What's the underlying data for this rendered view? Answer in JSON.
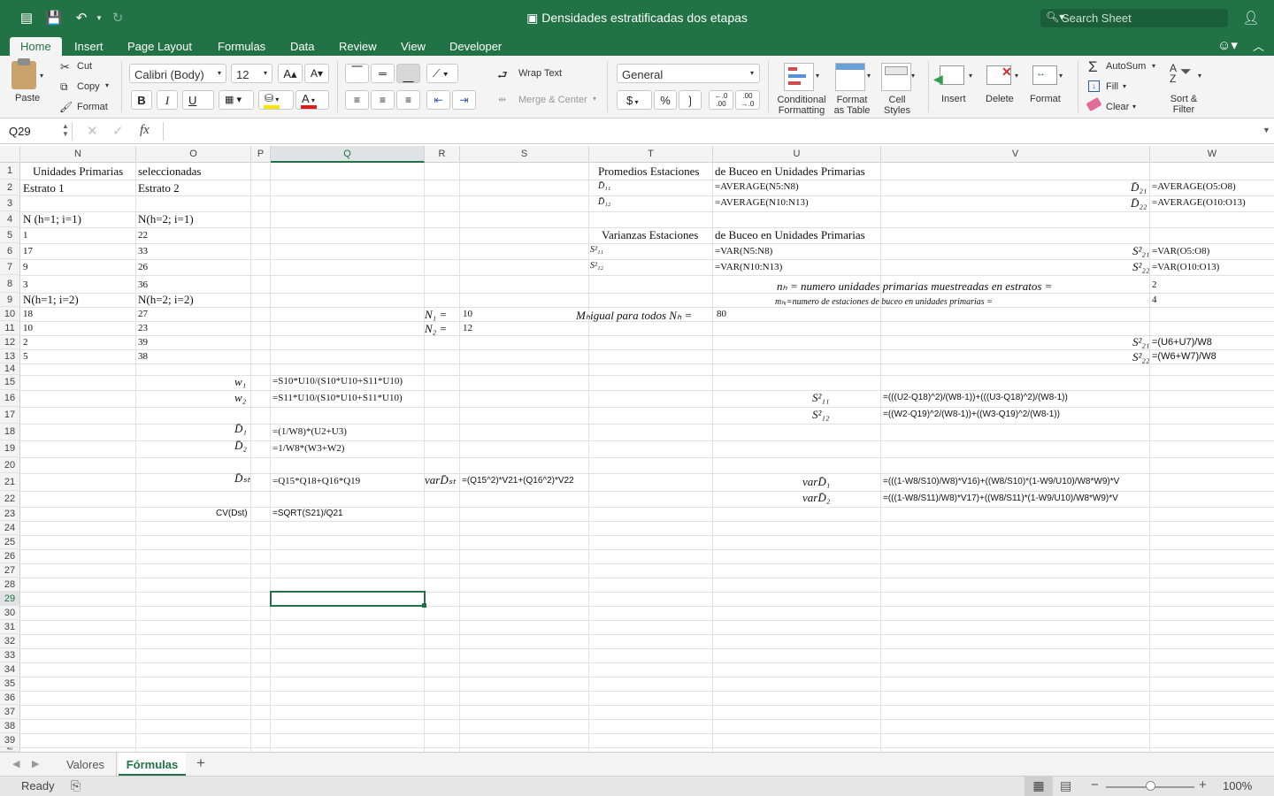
{
  "title": "Densidades estratificadas dos etapas",
  "search_placeholder": "Search Sheet",
  "tabs": [
    "Home",
    "Insert",
    "Page Layout",
    "Formulas",
    "Data",
    "Review",
    "View",
    "Developer"
  ],
  "ribbon": {
    "paste": "Paste",
    "cut": "Cut",
    "copy": "Copy",
    "format": "Format",
    "font_name": "Calibri (Body)",
    "font_size": "12",
    "bold": "B",
    "italic": "I",
    "underline": "U",
    "wrap_text": "Wrap Text",
    "merge_center": "Merge & Center",
    "number_format": "General",
    "currency": "$",
    "percent": "%",
    "comma": "❳",
    "inc_decimal": "←.0\n.00",
    "dec_decimal": ".00\n→.0",
    "conditional_formatting": "Conditional\nFormatting",
    "format_as_table": "Format\nas Table",
    "cell_styles": "Cell\nStyles",
    "insert": "Insert",
    "delete": "Delete",
    "format_cells": "Format",
    "autosum": "AutoSum",
    "fill": "Fill",
    "clear": "Clear",
    "sort_filter": "Sort &\nFilter"
  },
  "namebox": "Q29",
  "formula_value": "",
  "columns": [
    "N",
    "O",
    "P",
    "Q",
    "R",
    "S",
    "T",
    "U",
    "V",
    "W"
  ],
  "rows": [
    "1",
    "2",
    "3",
    "4",
    "5",
    "6",
    "7",
    "8",
    "9",
    "10",
    "11",
    "12",
    "13",
    "14",
    "15",
    "16",
    "17",
    "18",
    "19",
    "20",
    "21",
    "22",
    "23",
    "24",
    "25",
    "26",
    "27",
    "28",
    "29",
    "30",
    "31",
    "32",
    "33",
    "34",
    "35",
    "36",
    "37",
    "38",
    "39",
    "40"
  ],
  "cells": {
    "n1": "Unidades Primarias",
    "o1": "seleccionadas",
    "t1": "Promedios Estaciones",
    "u1": "de Buceo en Unidades Primarias",
    "n2": "Estrato 1",
    "o2": "Estrato 2",
    "t2": "D̄₁₁",
    "u2": "=AVERAGE(N5:N8)",
    "vlab2": "D̄₂₁",
    "w2": "=AVERAGE(O5:O8)",
    "t3": "D̄₁₂",
    "u3": "=AVERAGE(N10:N13)",
    "vlab3": "D̄₂₂",
    "w3": "=AVERAGE(O10:O13)",
    "n4": "N (h=1; i=1)",
    "o4": "N(h=2; i=1)",
    "n5": "1",
    "o5": "22",
    "t5": "Varianzas Estaciones",
    "u5": "de Buceo en Unidades Primarias",
    "n6": "17",
    "o6": "33",
    "t6": "S²₁₁",
    "u6": "=VAR(N5:N8)",
    "vlab6": "S²₂₁",
    "w6": "=VAR(O5:O8)",
    "n7": "9",
    "o7": "26",
    "t7": "S²₁₂",
    "u7": "=VAR(N10:N13)",
    "vlab7": "S²₂₂",
    "w7": "=VAR(O10:O13)",
    "n8": "3",
    "o8": "36",
    "u8": "nₕ = numero unidades primarias muestreadas en estratos =",
    "w8": "2",
    "n9": "N(h=1; i=2)",
    "o9": "N(h=2; i=2)",
    "u9": "mₕᵢ=numero de estaciones de buceo en unidades primarias =",
    "w9": "4",
    "n10": "18",
    "o10": "27",
    "r10": "N₁ =",
    "s10": "10",
    "t10": "Mₕigual para todos Nₕ =",
    "u10": "80",
    "n11": "10",
    "o11": "23",
    "r11": "N₂ =",
    "s11": "12",
    "n12": "2",
    "o12": "39",
    "vlab12": "S²₂₁",
    "w12": "=(U6+U7)/W8",
    "n13": "5",
    "o13": "38",
    "vlab13": "S²₂₂",
    "w13": "=(W6+W7)/W8",
    "p15": "w₁",
    "q15": "=S10*U10/(S10*U10+S11*U10)",
    "p16": "w₂",
    "q16": "=S11*U10/(S10*U10+S11*U10)",
    "ulab16": "S²₁₁",
    "v16": "=(((U2-Q18)^2)/(W8-1))+(((U3-Q18)^2)/(W8-1))",
    "ulab17": "S²₁₂",
    "v17": "=((W2-Q19)^2/(W8-1))+((W3-Q19)^2/(W8-1))",
    "p18": "D̄₁",
    "q18": "=(1/W8)*(U2+U3)",
    "p19": "D̄₂",
    "q19": "=1/W8*(W3+W2)",
    "p21": "D̄ₛₜ",
    "q21": "=Q15*Q18+Q16*Q19",
    "r21": "varD̄ₛₜ",
    "s21": "=(Q15^2)*V21+(Q16^2)*V22",
    "ulab21": "varD̄₁",
    "v21": "=(((1-W8/S10)/W8)*V16)+((W8/S10)*(1-W9/U10)/W8*W9)*V",
    "ulab22": "varD̄₂",
    "v22": "=(((1-W8/S11)/W8)*V17)+((W8/S11)*(1-W9/U10)/W8*W9)*V",
    "p23": "CV(Dst)",
    "q23": "=SQRT(S21)/Q21"
  },
  "sheets": [
    "Valores",
    "Fórmulas"
  ],
  "status": "Ready",
  "zoom": "100%",
  "accent": "#217346"
}
